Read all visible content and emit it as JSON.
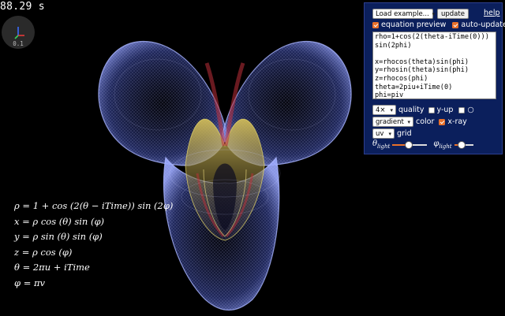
{
  "viewport": {
    "timer": "88.29 s",
    "zoom": "0.1"
  },
  "equations": [
    "ρ = 1 + cos (2(θ − iTime)) sin (2φ)",
    "x = ρ cos (θ) sin (φ)",
    "y = ρ sin (θ) sin (φ)",
    "z = ρ cos (φ)",
    "θ = 2πu + iTime",
    "φ = πv"
  ],
  "panel": {
    "example_select": "Load example...",
    "update_button": "update",
    "help_link": "help",
    "equation_preview": {
      "label": "equation preview",
      "checked": true
    },
    "auto_update": {
      "label": "auto-update",
      "checked": true
    },
    "code": "rho=1+cos(2(theta-iTime(0)))\nsin(2phi)\n\nx=rhocos(theta)sin(phi)\ny=rhosin(theta)sin(phi)\nz=rhocos(phi)\ntheta=2piu+iTime(0)\nphi=piv",
    "quality_select": "4×",
    "quality_label": "quality",
    "y_up": {
      "label": "y-up",
      "checked": false
    },
    "circle_toggle": {
      "label": "○",
      "checked": false
    },
    "color_select": "gradient",
    "color_label": "color",
    "xray": {
      "label": "x-ray",
      "checked": true
    },
    "grid_select": "uv",
    "grid_label": "grid",
    "theta_light": {
      "label": "θ",
      "sub": "light",
      "value": 0.48
    },
    "phi_light": {
      "label": "φ",
      "sub": "light",
      "value": 0.38
    }
  },
  "colors": {
    "panel_bg": "#0b1f5c",
    "accent": "#e8702a",
    "surface_blue": "#7d8ff0",
    "surface_yellow": "#e8d86a",
    "surface_red": "#c0303a"
  }
}
